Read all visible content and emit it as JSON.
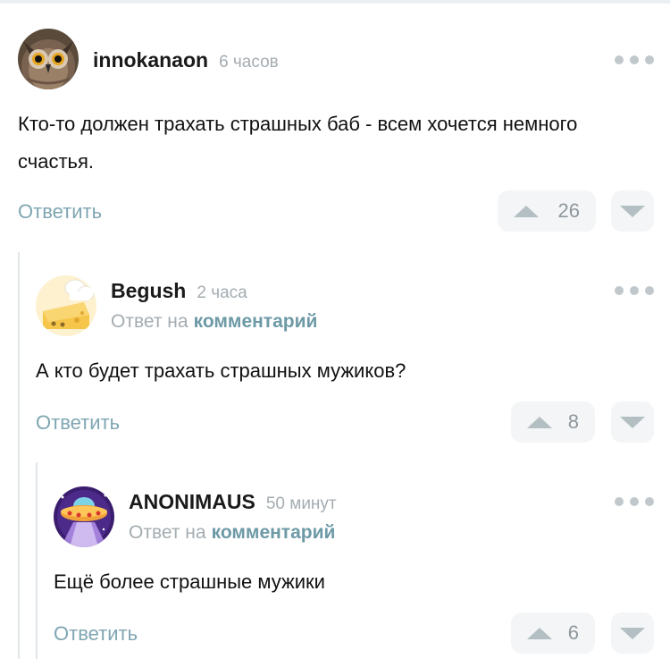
{
  "comments": [
    {
      "username": "innokanaon",
      "time": "6 часов",
      "text": "Кто-то должен трахать страшных баб - всем хочется немного счастья.",
      "reply_label": "Ответить",
      "votes": "26",
      "avatar_icon": "owl-avatar-icon"
    },
    {
      "username": "Begush",
      "time": "2 часа",
      "reply_prefix": "Ответ на",
      "reply_link": "комментарий",
      "text": "А кто будет трахать страшных мужиков?",
      "reply_label": "Ответить",
      "votes": "8",
      "avatar_icon": "cheese-chef-avatar-icon"
    },
    {
      "username": "ANONIMAUS",
      "time": "50 минут",
      "reply_prefix": "Ответ на",
      "reply_link": "комментарий",
      "text": "Ещё более страшные мужики",
      "reply_label": "Ответить",
      "votes": "6",
      "avatar_icon": "ufo-avatar-icon"
    }
  ],
  "colors": {
    "username": "#1a1a1a",
    "meta": "#a4acb1",
    "link": "#6d9aa6",
    "reply": "#7fa6b2",
    "vote_bg": "#f3f5f6",
    "vote_arrow": "#b4bfc4"
  }
}
